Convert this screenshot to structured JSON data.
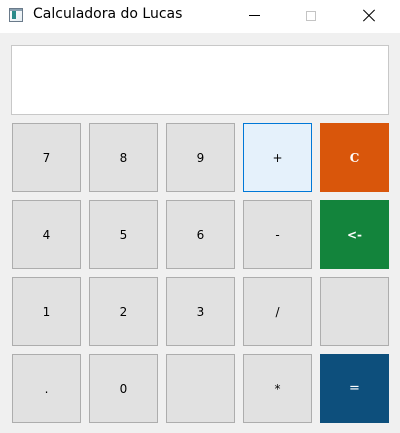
{
  "window": {
    "title": "Calculadora do Lucas",
    "controls": [
      "minimize",
      "maximize",
      "close"
    ]
  },
  "display": {
    "value": ""
  },
  "keypad": {
    "k7": "7",
    "k8": "8",
    "k9": "9",
    "plus": "+",
    "clear": "C",
    "k4": "4",
    "k5": "5",
    "k6": "6",
    "minus": "-",
    "backspace": "<-",
    "k1": "1",
    "k2": "2",
    "k3": "3",
    "divide": "/",
    "blank1": "",
    "dot": ".",
    "k0": "0",
    "blank2": "",
    "multiply": "*",
    "equals": "="
  },
  "colors": {
    "clear": "#d9560b",
    "backspace": "#13843c",
    "equals": "#0d4f7c",
    "focus_border": "#0078d7"
  }
}
